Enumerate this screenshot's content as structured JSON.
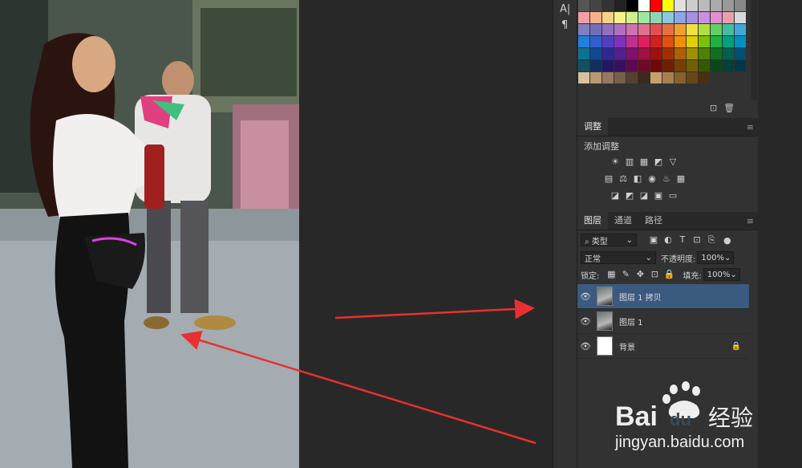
{
  "toolbar": {
    "char_icon": "A|",
    "para_icon": "¶"
  },
  "swatches": {
    "colors": [
      "#555555",
      "#444444",
      "#333333",
      "#222222",
      "#000000",
      "#ffffff",
      "#ff0000",
      "#ffff00",
      "#e0e0e0",
      "#cccccc",
      "#bbbbbb",
      "#aaaaaa",
      "#999999",
      "#888888",
      "#f0a0a0",
      "#f5b08a",
      "#f8d08a",
      "#f8f08a",
      "#d0f08a",
      "#a0e8a0",
      "#8ad8b0",
      "#8ac8e0",
      "#8aa8e8",
      "#a890e0",
      "#c890e0",
      "#e090d0",
      "#e8a0b0",
      "#d8d8d8",
      "#8080c0",
      "#7070b8",
      "#9070c0",
      "#b070c0",
      "#d070b0",
      "#e07090",
      "#e05050",
      "#e87040",
      "#f0a030",
      "#f0e040",
      "#b0e040",
      "#60d060",
      "#40c0a0",
      "#40a8d8",
      "#2080e0",
      "#3060d0",
      "#5040c0",
      "#8030c0",
      "#c03090",
      "#e02060",
      "#d02020",
      "#e05010",
      "#f09000",
      "#e0d000",
      "#80c000",
      "#20b040",
      "#00a080",
      "#0090c0",
      "#107090",
      "#104890",
      "#2a2a90",
      "#502090",
      "#801070",
      "#a01040",
      "#a01010",
      "#a03000",
      "#b06000",
      "#a09000",
      "#508000",
      "#107020",
      "#006050",
      "#005070",
      "#105060",
      "#103060",
      "#201860",
      "#381060",
      "#600850",
      "#700828",
      "#700808",
      "#702000",
      "#784000",
      "#706000",
      "#385800",
      "#084818",
      "#004038",
      "#003848",
      "#d8c0a0",
      "#b89878",
      "#987860",
      "#786048",
      "#584030",
      "#3a2a1c",
      "#c8a070",
      "#a88050",
      "#886030",
      "#684818",
      "#483010"
    ],
    "footer_icons": [
      "new-swatch-icon",
      "trash-icon"
    ]
  },
  "adjustments": {
    "tab_label": "调整",
    "add_label": "添加调整",
    "row1": [
      "☀",
      "▥",
      "▦",
      "◩",
      "▽"
    ],
    "row2": [
      "▤",
      "⚖",
      "◧",
      "◉",
      "♨",
      "▦"
    ],
    "row3": [
      "◪",
      "◩",
      "◪",
      "▣",
      "▭"
    ]
  },
  "layers_panel": {
    "tabs": [
      "图层",
      "通道",
      "路径"
    ],
    "filter": {
      "value": "类型",
      "icon_chars": [
        "▣",
        "◐",
        "T",
        "⊡",
        "⎘"
      ]
    },
    "blend_mode": "正常",
    "opacity_label": "不透明度:",
    "opacity_value": "100%",
    "lock_label": "锁定:",
    "lock_icons": [
      "▦",
      "✎",
      "✥",
      "⊡",
      "🔒"
    ],
    "fill_label": "填充:",
    "fill_value": "100%",
    "layers": [
      {
        "name": "图层 1 拷贝",
        "selected": true,
        "visible": true,
        "locked": false
      },
      {
        "name": "图层 1",
        "selected": false,
        "visible": true,
        "locked": false
      },
      {
        "name": "背景",
        "selected": false,
        "visible": true,
        "locked": true
      }
    ]
  },
  "watermark": {
    "logo_text": "Bai",
    "logo_text2": "du",
    "brand_cn": "经验",
    "url": "jingyan.baidu.com"
  },
  "colors": {
    "accent_selected": "#3a5a80",
    "panel_bg": "#323232",
    "arrow_red": "#e83030"
  }
}
